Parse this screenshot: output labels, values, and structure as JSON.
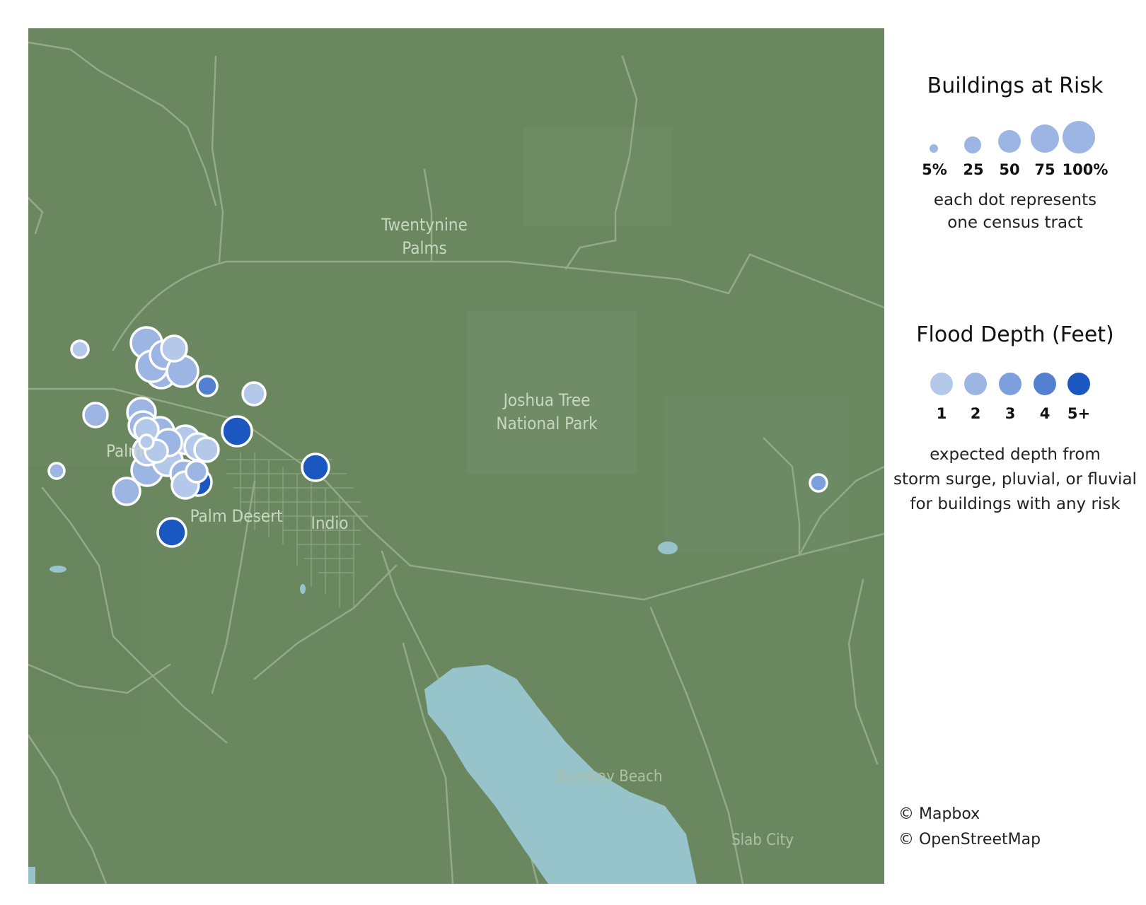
{
  "map": {
    "place_labels": {
      "twentynine_palms": "Twentynine\nPalms",
      "joshua_tree": "Joshua Tree\nNational Park",
      "palm": "Palm",
      "palm_desert": "Palm Desert",
      "indio": "Indio",
      "bombay_beach": "Bombay Beach",
      "slab_city": "Slab City"
    },
    "colors": {
      "land": "#6a8760",
      "road": "#93a98a",
      "water": "#97c3cb",
      "depth_1": "#b4c8ea",
      "depth_2": "#9cb5e3",
      "depth_3": "#7d9fdd",
      "depth_4": "#5380d0",
      "depth_5": "#1a57c0"
    }
  },
  "legend": {
    "size_title": "Buildings at Risk",
    "size_labels": [
      "5%",
      "25",
      "50",
      "75",
      "100%"
    ],
    "size_note": "each dot represents\none census tract",
    "depth_title": "Flood Depth (Feet)",
    "depth_labels": [
      "1",
      "2",
      "3",
      "4",
      "5+"
    ],
    "depth_note": "expected depth from\nstorm surge, pluvial, or fluvial\nfor buildings with any risk"
  },
  "attribution": {
    "mapbox": "© Mapbox",
    "osm": "© OpenStreetMap"
  }
}
